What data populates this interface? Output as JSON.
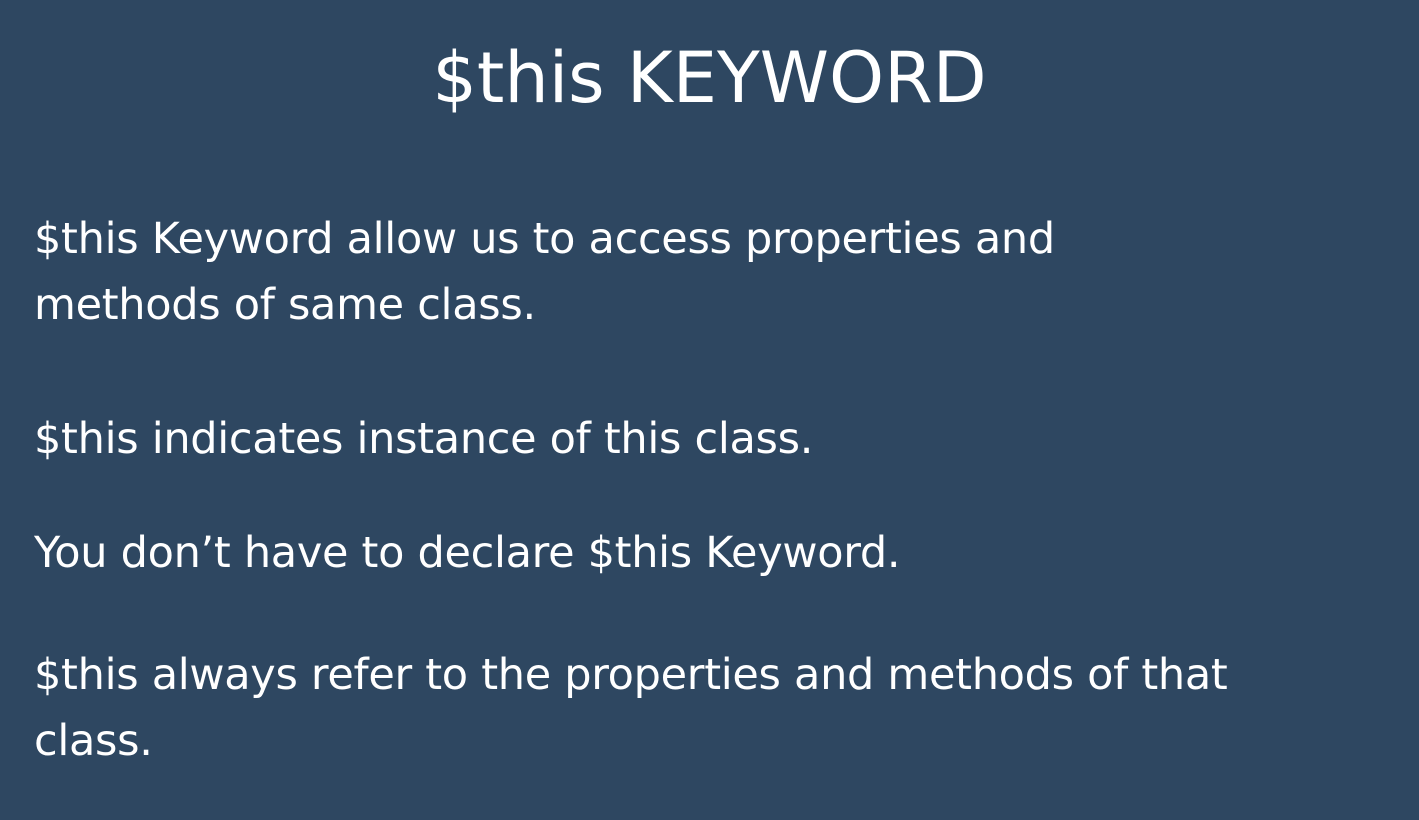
{
  "slide": {
    "title": "$this KEYWORD",
    "paragraphs": [
      {
        "lines": [
          "$this Keyword allow us to access properties and",
          "methods of same class."
        ]
      },
      {
        "lines": [
          "$this indicates instance of this class."
        ]
      },
      {
        "lines": [
          "You don’t have to declare $this Keyword."
        ]
      },
      {
        "lines": [
          "$this always refer to the properties and methods of that",
          "class."
        ]
      }
    ],
    "colors": {
      "background": "#2e4761",
      "text": "#ffffff"
    }
  }
}
